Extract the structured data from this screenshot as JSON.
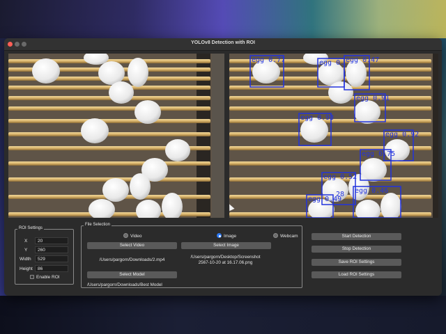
{
  "window": {
    "title": "YOLOv8 Detection with ROI"
  },
  "detections": [
    {
      "label": "egg 0.77"
    },
    {
      "label": "egg 0."
    },
    {
      "label": "egg 0.47"
    },
    {
      "label": "egg 0.91"
    },
    {
      "label": "egg 0.93"
    },
    {
      "label": "egg 0.92"
    },
    {
      "label": "egg 0.75"
    },
    {
      "label": "egg 0.52"
    },
    {
      "label": "egg 0.46"
    },
    {
      "label": "egg 0.49"
    },
    {
      "label": "28"
    }
  ],
  "roi": {
    "title": "ROI Settings",
    "x_label": "X",
    "x_value": "20",
    "y_label": "Y",
    "y_value": "260",
    "width_label": "Width",
    "width_value": "529",
    "height_label": "Height",
    "height_value": "86",
    "enable_label": "Enable ROI",
    "enable_checked": false
  },
  "file_selection": {
    "title": "File Selection",
    "video_label": "Video",
    "image_label": "Image",
    "webcam_label": "Webcam",
    "selected": "Image",
    "select_video": "Select Video",
    "select_image": "Select Image",
    "select_model": "Select Model",
    "video_path": "/Users/pargorn/Downloads/2.mp4",
    "image_path_1": "/Users/pargorn/Desktop/Screenshot",
    "image_path_2": "2567-10-20 at 16.17.06.png",
    "model_path": "/Users/pargorn/Downloads/Best Model"
  },
  "actions": {
    "start": "Start Detection",
    "stop": "Stop Detection",
    "save_roi": "Save ROI Settings",
    "load_roi": "Load ROI Settings"
  },
  "colors": {
    "box": "#2233dd",
    "accent": "#2f7bf5",
    "button": "#5a5a5a"
  }
}
